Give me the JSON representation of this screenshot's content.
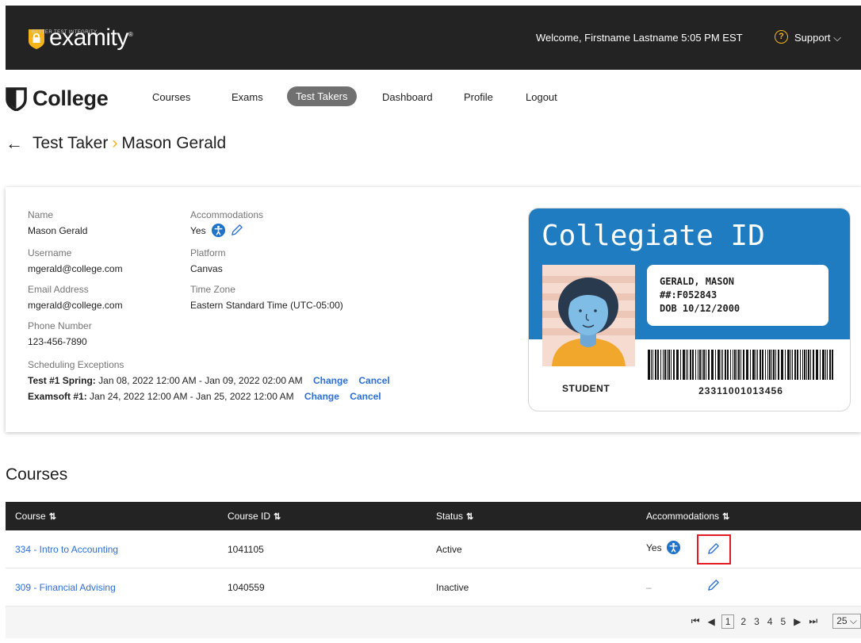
{
  "header": {
    "brand": "examity",
    "brand_mark": "®",
    "tagline": "BETTER TEST INTEGRITY.",
    "welcome": "Welcome, Firstname Lastname  5:05 PM  EST",
    "support": "Support ⌵"
  },
  "nav": {
    "logo": "College",
    "items": [
      "Courses",
      "Exams",
      "Test Takers",
      "Dashboard",
      "Profile",
      "Logout"
    ],
    "active": "Test Takers"
  },
  "breadcrumb": {
    "parent": "Test Taker",
    "separator": "›",
    "current": "Mason Gerald"
  },
  "profile": {
    "name_label": "Name",
    "name": "Mason Gerald",
    "username_label": "Username",
    "username": "mgerald@college.com",
    "email_label": "Email Address",
    "email": "mgerald@college.com",
    "phone_label": "Phone Number",
    "phone": "123-456-7890",
    "accommodations_label": "Accommodations",
    "accommodations": "Yes",
    "platform_label": "Platform",
    "platform": "Canvas",
    "timezone_label": "Time Zone",
    "timezone": "Eastern Standard Time (UTC-05:00)",
    "exceptions_label": "Scheduling Exceptions",
    "exceptions": [
      {
        "name": "Test #1 Spring:",
        "range": "Jan 08, 2022 12:00 AM - Jan 09, 2022 02:00 AM",
        "change": "Change",
        "cancel": "Cancel"
      },
      {
        "name": "Examsoft #1:",
        "range": "Jan 24, 2022 12:00 AM - Jan 25, 2022 12:00 AM",
        "change": "Change",
        "cancel": "Cancel"
      }
    ]
  },
  "id_card": {
    "title": "Collegiate ID",
    "line1": "GERALD, MASON",
    "line2": "##:F052843",
    "line3": "DOB  10/12/2000",
    "role": "STUDENT",
    "barcode_number": "23311001013456"
  },
  "courses": {
    "title": "Courses",
    "columns": [
      "Course",
      "Course ID",
      "Status",
      "Accommodations"
    ],
    "sort_icon": "⇅",
    "rows": [
      {
        "course": "334 - Intro to Accounting",
        "id": "1041105",
        "status": "Active",
        "accommodations": "Yes"
      },
      {
        "course": "309 - Financial Advising",
        "id": "1040559",
        "status": "Inactive",
        "accommodations": "–"
      }
    ],
    "pager": {
      "pages": [
        "1",
        "2",
        "3",
        "4",
        "5"
      ],
      "current": "1",
      "per_page": "25 ⌵"
    }
  },
  "colors": {
    "accent": "#f5b51a",
    "link": "#2c6fd6",
    "header_bg": "#232323",
    "id_blue": "#1f7cc1",
    "highlight": "#e31b23"
  }
}
